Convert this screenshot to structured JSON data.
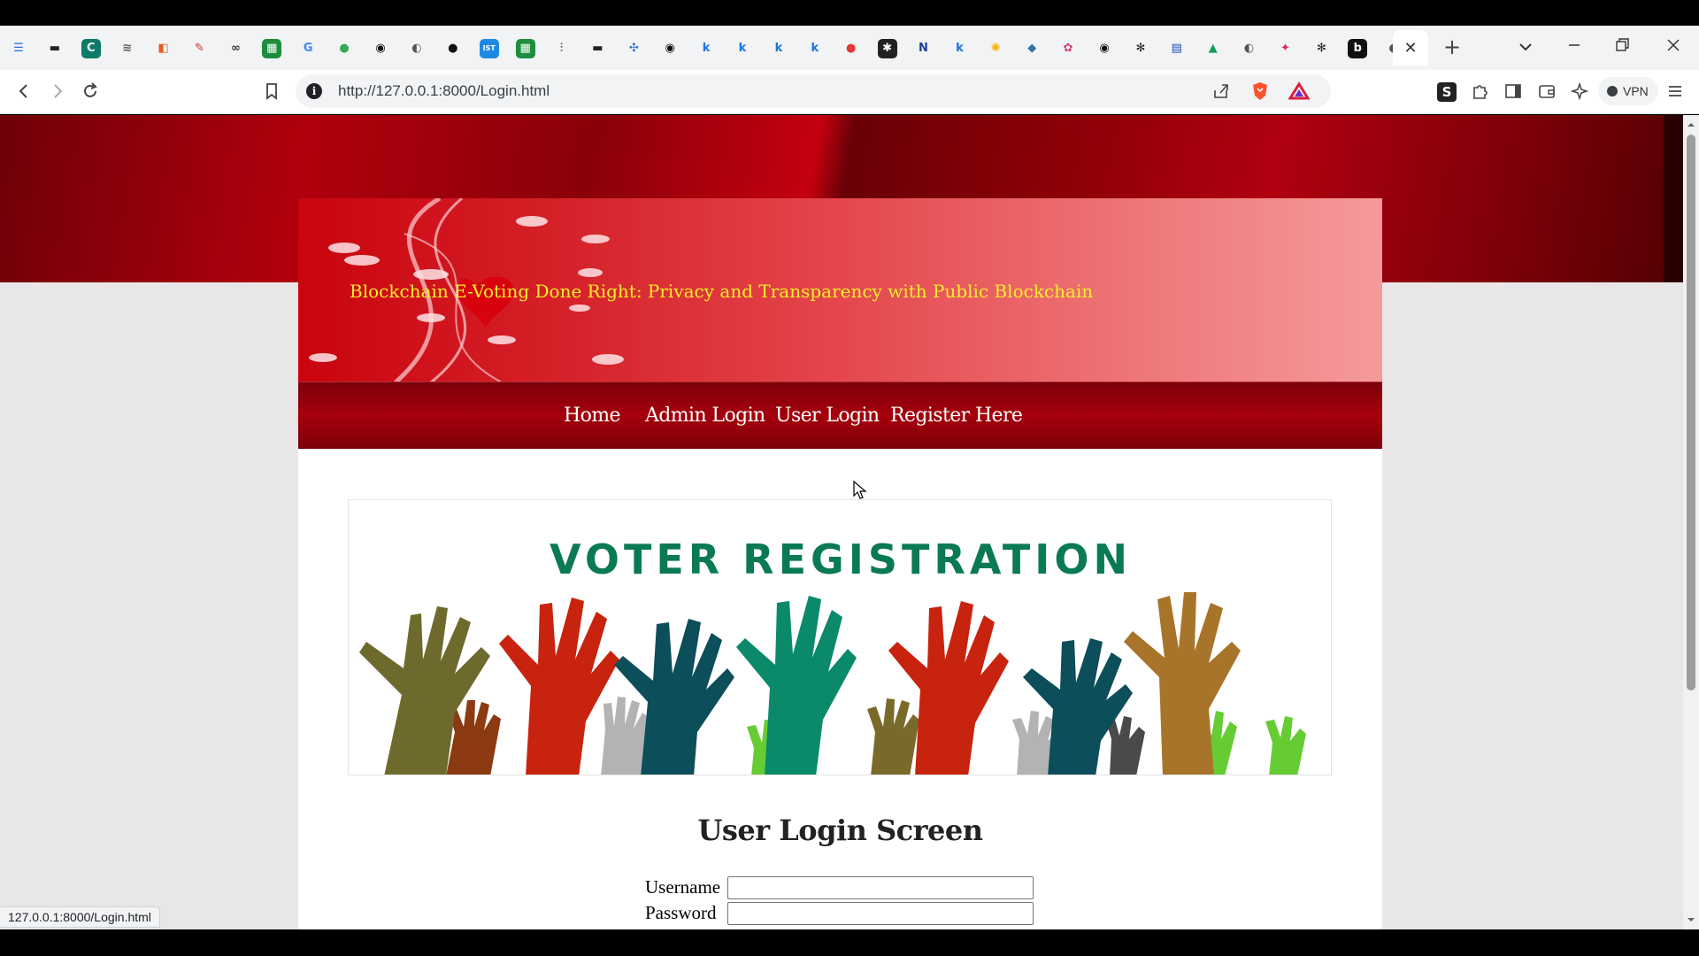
{
  "browser": {
    "tab_favicons": [
      {
        "icon": "list-icon",
        "glyph": "☰",
        "color": "#2a6ad8",
        "bg": "transparent"
      },
      {
        "icon": "car-icon",
        "glyph": "▬",
        "color": "#222",
        "bg": "transparent"
      },
      {
        "icon": "c-app-icon",
        "glyph": "C",
        "color": "#fff",
        "bg": "#0d7b6a"
      },
      {
        "icon": "cisco-icon",
        "glyph": "≋",
        "color": "#555",
        "bg": "transparent"
      },
      {
        "icon": "office-icon",
        "glyph": "◧",
        "color": "#e85a18",
        "bg": "transparent"
      },
      {
        "icon": "edit-icon",
        "glyph": "✎",
        "color": "#d32f2f",
        "bg": "transparent"
      },
      {
        "icon": "glasses-icon",
        "glyph": "∞",
        "color": "#333",
        "bg": "transparent"
      },
      {
        "icon": "sheets-icon",
        "glyph": "▦",
        "color": "#fff",
        "bg": "#1e8e3e"
      },
      {
        "icon": "google-icon",
        "glyph": "G",
        "color": "#4285f4",
        "bg": "transparent"
      },
      {
        "icon": "person-icon",
        "glyph": "●",
        "color": "#34a853",
        "bg": "transparent"
      },
      {
        "icon": "github-icon",
        "glyph": "◉",
        "color": "#111",
        "bg": "transparent"
      },
      {
        "icon": "globe-icon",
        "glyph": "◐",
        "color": "#555",
        "bg": "transparent"
      },
      {
        "icon": "dash-icon",
        "glyph": "●",
        "color": "#111",
        "bg": "transparent"
      },
      {
        "icon": "ist-icon",
        "glyph": "IST",
        "color": "#fff",
        "bg": "#1e88e5"
      },
      {
        "icon": "sheets-icon",
        "glyph": "▦",
        "color": "#fff",
        "bg": "#1e8e3e"
      },
      {
        "icon": "cisco-icon",
        "glyph": "⫶",
        "color": "#555",
        "bg": "transparent"
      },
      {
        "icon": "car-icon",
        "glyph": "▬",
        "color": "#222",
        "bg": "transparent"
      },
      {
        "icon": "puzzle-icon",
        "glyph": "✣",
        "color": "#2b6fd6",
        "bg": "transparent"
      },
      {
        "icon": "github-icon",
        "glyph": "◉",
        "color": "#111",
        "bg": "transparent"
      },
      {
        "icon": "k-icon",
        "glyph": "k",
        "color": "#1a73e8",
        "bg": "transparent"
      },
      {
        "icon": "k-icon",
        "glyph": "k",
        "color": "#1a73e8",
        "bg": "transparent"
      },
      {
        "icon": "k-icon",
        "glyph": "k",
        "color": "#1a73e8",
        "bg": "transparent"
      },
      {
        "icon": "k-icon",
        "glyph": "k",
        "color": "#1a73e8",
        "bg": "transparent"
      },
      {
        "icon": "record-icon",
        "glyph": "●",
        "color": "#e53935",
        "bg": "transparent"
      },
      {
        "icon": "spark-icon",
        "glyph": "✱",
        "color": "#fff",
        "bg": "#222"
      },
      {
        "icon": "notion-icon",
        "glyph": "N",
        "color": "#1a3fa0",
        "bg": "transparent"
      },
      {
        "icon": "k-icon",
        "glyph": "k",
        "color": "#1a73e8",
        "bg": "transparent"
      },
      {
        "icon": "sun-icon",
        "glyph": "✺",
        "color": "#f4b400",
        "bg": "transparent"
      },
      {
        "icon": "python-icon",
        "glyph": "◆",
        "color": "#3772a4",
        "bg": "transparent"
      },
      {
        "icon": "flower-icon",
        "glyph": "✿",
        "color": "#d23c7a",
        "bg": "transparent"
      },
      {
        "icon": "github-icon",
        "glyph": "◉",
        "color": "#111",
        "bg": "transparent"
      },
      {
        "icon": "openai-icon",
        "glyph": "✻",
        "color": "#222",
        "bg": "transparent"
      },
      {
        "icon": "window-icon",
        "glyph": "▤",
        "color": "#1a47b8",
        "bg": "transparent"
      },
      {
        "icon": "drive-icon",
        "glyph": "▲",
        "color": "#0f9d58",
        "bg": "transparent"
      },
      {
        "icon": "globe-icon",
        "glyph": "◐",
        "color": "#555",
        "bg": "transparent"
      },
      {
        "icon": "colorful-icon",
        "glyph": "✦",
        "color": "#e91e63",
        "bg": "transparent"
      },
      {
        "icon": "openai-icon",
        "glyph": "✻",
        "color": "#222",
        "bg": "transparent"
      },
      {
        "icon": "b-icon",
        "glyph": "b",
        "color": "#fff",
        "bg": "#111"
      },
      {
        "icon": "globe-icon",
        "glyph": "◐",
        "color": "#555",
        "bg": "transparent"
      }
    ],
    "active_tab_close": "✕",
    "new_tab": "+",
    "address_url": "http://127.0.0.1:8000/Login.html",
    "vpn_label": "VPN",
    "status_url": "127.0.0.1:8000/Login.html"
  },
  "page": {
    "banner_title": "Blockchain E-Voting Done Right: Privacy and Transparency with Public Blockchain",
    "nav": [
      "Home",
      "Admin Login",
      "User Login",
      "Register Here"
    ],
    "hero_title": "VOTER REGISTRATION",
    "login_heading": "User Login Screen",
    "username_label": "Username",
    "password_label": "Password",
    "username_value": "",
    "password_value": ""
  },
  "colors": {
    "banner_text": "#f7ef2a",
    "hero_text": "#0a7a55",
    "nav_background": "#a5000c"
  }
}
